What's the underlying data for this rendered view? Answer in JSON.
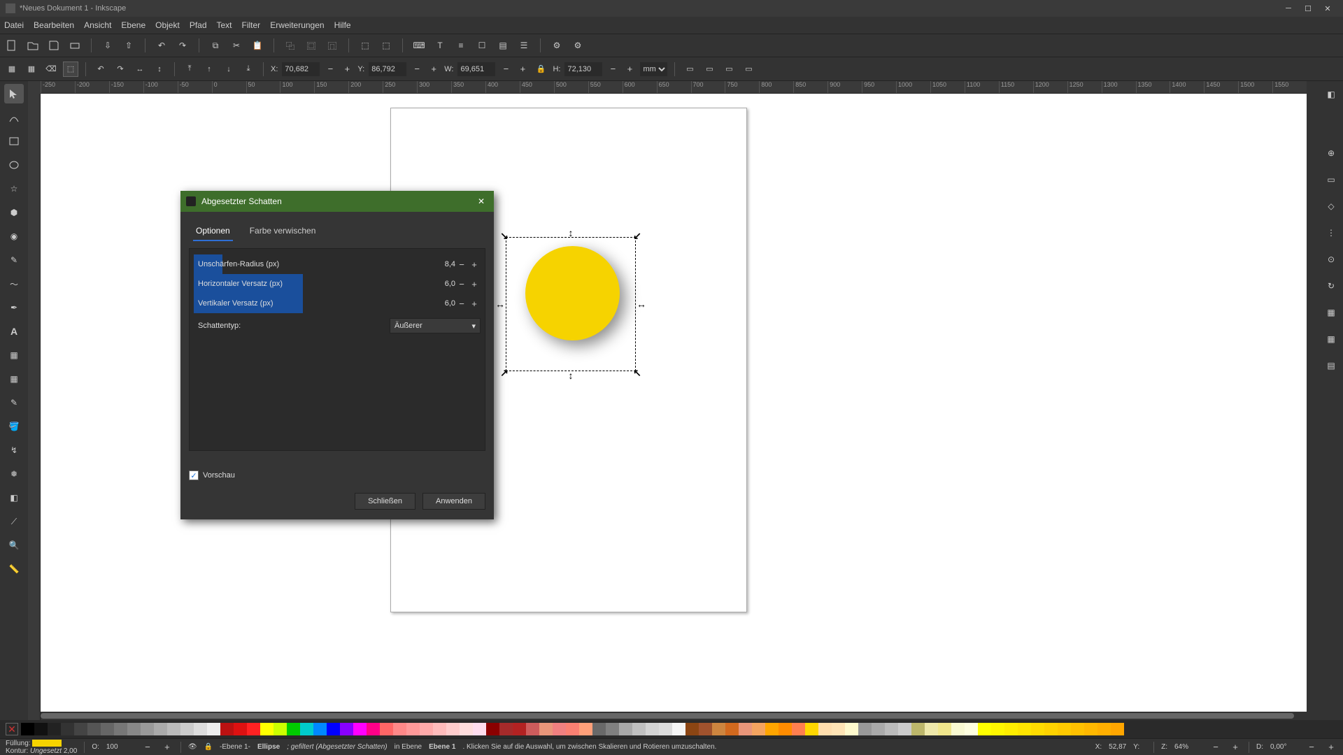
{
  "title": "*Neues Dokument 1 - Inkscape",
  "menu": [
    "Datei",
    "Bearbeiten",
    "Ansicht",
    "Ebene",
    "Objekt",
    "Pfad",
    "Text",
    "Filter",
    "Erweiterungen",
    "Hilfe"
  ],
  "coords": {
    "x_label": "X:",
    "x": "70,682",
    "y_label": "Y:",
    "y": "86,792",
    "w_label": "W:",
    "w": "69,651",
    "h_label": "H:",
    "h": "72,130",
    "unit": "mm"
  },
  "ruler_marks": [
    "-250",
    "-200",
    "-150",
    "-100",
    "-50",
    "0",
    "50",
    "100",
    "150",
    "200",
    "250",
    "300",
    "350",
    "400",
    "450",
    "500",
    "550",
    "600",
    "650",
    "700",
    "750",
    "800",
    "850",
    "900",
    "950",
    "1000",
    "1050",
    "1100",
    "1150",
    "1200",
    "1250",
    "1300",
    "1350",
    "1400",
    "1450",
    "1500",
    "1550"
  ],
  "dialog": {
    "title": "Abgesetzter Schatten",
    "tabs": [
      "Optionen",
      "Farbe verwischen"
    ],
    "params": [
      {
        "label": "Unschärfen-Radius (px)",
        "value": "8,4",
        "fill_pct": 10
      },
      {
        "label": "Horizontaler Versatz (px)",
        "value": "6,0",
        "fill_pct": 38
      },
      {
        "label": "Vertikaler Versatz (px)",
        "value": "6,0",
        "fill_pct": 38
      }
    ],
    "type_label": "Schattentyp:",
    "type_value": "Äußerer",
    "preview_label": "Vorschau",
    "close": "Schließen",
    "apply": "Anwenden"
  },
  "status": {
    "fill_label": "Füllung:",
    "stroke_label": "Kontur:",
    "stroke_value": "Ungesetzt",
    "stroke_width": "2,00",
    "opacity_label": "O:",
    "opacity": "100",
    "layer": "-Ebene 1-",
    "object": "Ellipse",
    "filter_info": "; gefiltert (Abgesetzter Schatten)",
    "hint_prefix": " in Ebene ",
    "hint_layer": "Ebene 1",
    "hint_rest": ". Klicken Sie auf die Auswahl, um zwischen Skalieren und Rotieren umzuschalten.",
    "cursor_x_label": "X:",
    "cursor_x": "52,87",
    "cursor_y_label": "Y:",
    "cursor_y": "   ",
    "zoom_label": "Z:",
    "zoom": "64%",
    "rot_label": "D:",
    "rot": "0,00°"
  },
  "palette_colors": [
    "#000",
    "#111",
    "#222",
    "#333",
    "#444",
    "#555",
    "#666",
    "#777",
    "#888",
    "#999",
    "#aaa",
    "#bbb",
    "#ccc",
    "#ddd",
    "#eee",
    "#b11",
    "#d11",
    "#f22",
    "#ff0",
    "#cf0",
    "#0c0",
    "#0cc",
    "#08f",
    "#00f",
    "#80f",
    "#f0f",
    "#f08",
    "#f66",
    "#f88",
    "#f99",
    "#faa",
    "#fbb",
    "#fcc",
    "#fdd",
    "#fde",
    "#8b0000",
    "#a52a2a",
    "#b22222",
    "#cd5c5c",
    "#e9967a",
    "#f08080",
    "#fa8072",
    "#ffa07a",
    "#696969",
    "#808080",
    "#a9a9a9",
    "#c0c0c0",
    "#d3d3d3",
    "#dcdcdc",
    "#f5f5f5",
    "#8b4513",
    "#a0522d",
    "#cd853f",
    "#d2691e",
    "#e9967a",
    "#f4a460",
    "#ffa500",
    "#ff8c00",
    "#ff7f50",
    "#ffd700",
    "#ffdead",
    "#ffe4b5",
    "#fffacd",
    "#999",
    "#aaa",
    "#bbb",
    "#ccc",
    "#bdb76b",
    "#eee8aa",
    "#f0e68c",
    "#fafad2",
    "#ffffe0",
    "#ffff00",
    "#fff700",
    "#ffee00",
    "#ffe500",
    "#ffdc00",
    "#ffd300",
    "#ffca00",
    "#ffc100",
    "#ffb800",
    "#ffaf00",
    "#ffa600"
  ]
}
